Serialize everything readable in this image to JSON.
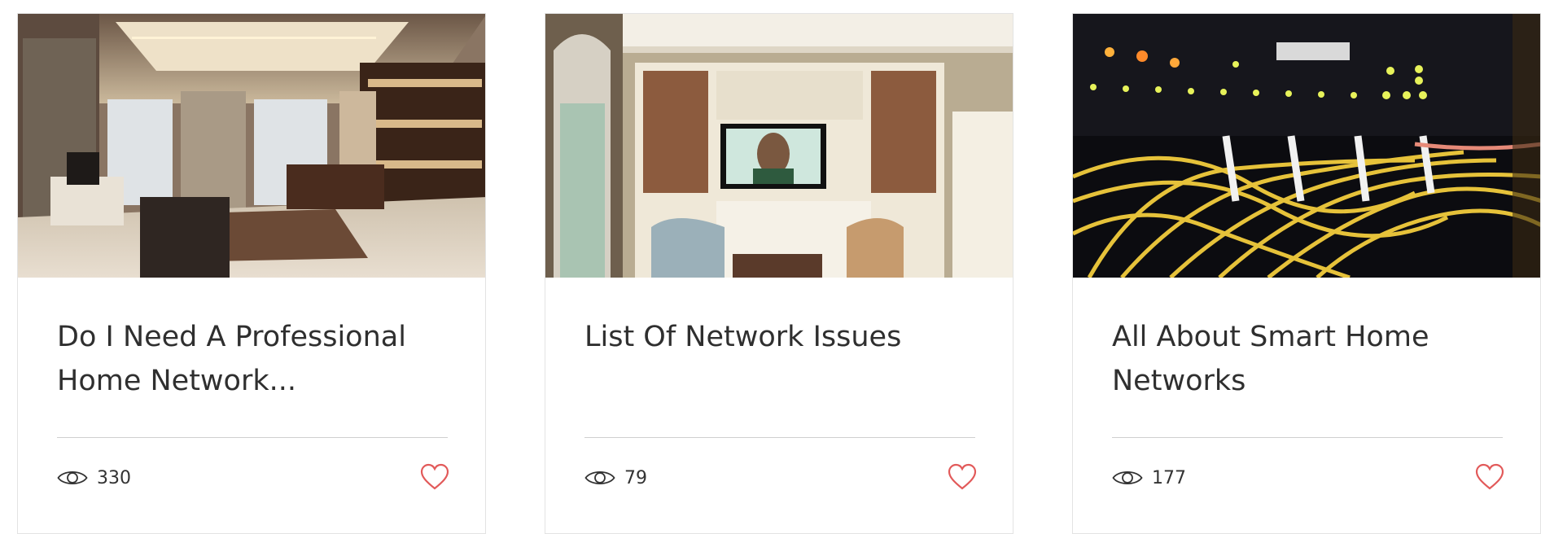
{
  "colors": {
    "heart": "#e25a5a",
    "divider": "#cfcfcf",
    "title_text": "#2f2f2f"
  },
  "posts": [
    {
      "title": "Do I Need A Professional Home Network...",
      "views": "330",
      "image": "home-office-interior-photo"
    },
    {
      "title": "List Of Network Issues",
      "views": "79",
      "image": "living-room-tv-photo"
    },
    {
      "title": "All About Smart Home Networks",
      "views": "177",
      "image": "network-cables-server-photo"
    }
  ]
}
